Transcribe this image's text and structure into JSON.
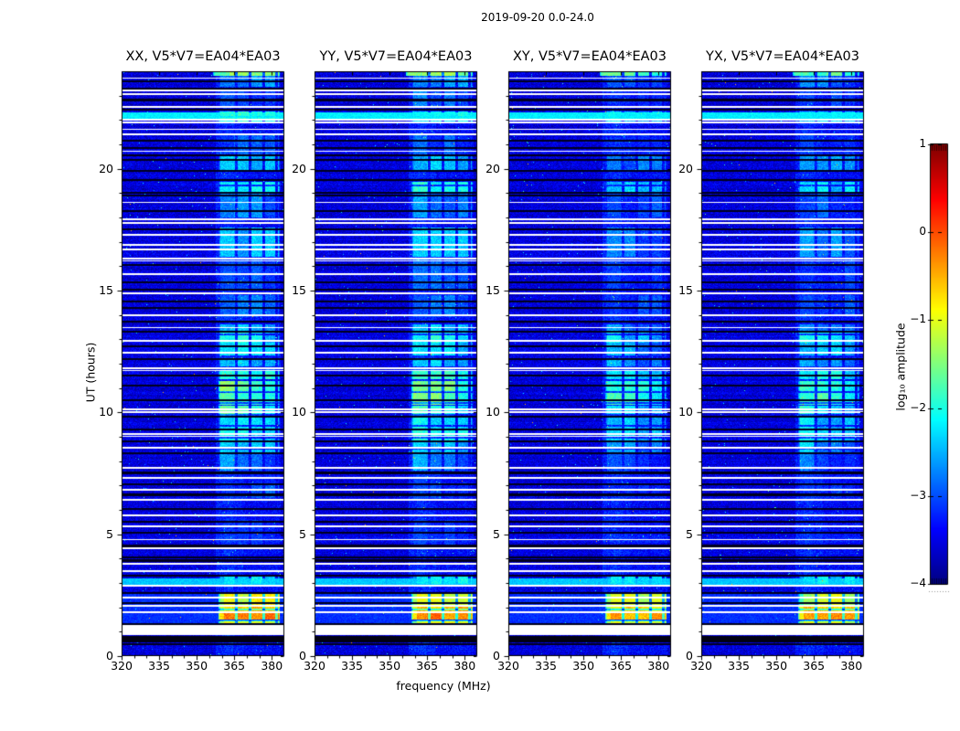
{
  "chart_data": {
    "type": "heatmap",
    "title": "2019-09-20 0.0-24.0",
    "xlabel": "frequency (MHz)",
    "ylabel": "UT (hours)",
    "x_ticks": [
      320,
      335,
      350,
      365,
      380
    ],
    "y_ticks": [
      0,
      5,
      10,
      15,
      20
    ],
    "x_range_mhz": [
      320,
      385
    ],
    "y_range_hours": [
      0,
      24
    ],
    "value_scale": "log10 amplitude",
    "value_range": [
      -4,
      1
    ],
    "colormap": "jet",
    "panels": [
      {
        "title": "XX, V5*V7=EA04*EA03",
        "pol": "XX",
        "band_offset": 0
      },
      {
        "title": "YY, V5*V7=EA04*EA03",
        "pol": "YY",
        "band_offset": 0.05
      },
      {
        "title": "XY, V5*V7=EA04*EA03",
        "pol": "XY",
        "band_offset": -0.3
      },
      {
        "title": "YX, V5*V7=EA04*EA03",
        "pol": "YX",
        "band_offset": -0.22
      }
    ],
    "colorbar": {
      "label": "log₁₀ amplitude",
      "ticks": [
        "1",
        "0",
        "−1",
        "−2",
        "−3",
        "−4"
      ],
      "vmin": -4,
      "vmax": 1
    },
    "features": {
      "background_level": -3.55,
      "rfi_band_mhz": [
        358.8,
        383.3
      ],
      "band_gap_freqs_mhz": [
        365.9,
        371.3,
        376.7,
        381.9
      ],
      "band_segments": [
        [
          23.82,
          24.0,
          -1.5
        ],
        [
          23.35,
          23.8,
          -2.7
        ],
        [
          22.55,
          23.3,
          -3.0
        ],
        [
          21.95,
          22.35,
          -2.1
        ],
        [
          20.6,
          21.4,
          -3.1
        ],
        [
          19.9,
          20.55,
          -2.5
        ],
        [
          19.05,
          19.45,
          -2.15
        ],
        [
          18.0,
          19.0,
          -2.85
        ],
        [
          16.4,
          17.6,
          -2.6
        ],
        [
          15.0,
          16.3,
          -3.0
        ],
        [
          13.9,
          14.8,
          -2.9
        ],
        [
          13.35,
          13.78,
          -2.3
        ],
        [
          12.88,
          13.3,
          -1.95
        ],
        [
          12.35,
          12.85,
          -2.1
        ],
        [
          11.88,
          12.3,
          -2.25
        ],
        [
          11.35,
          11.85,
          -1.7
        ],
        [
          10.85,
          11.3,
          -1.4
        ],
        [
          10.32,
          10.8,
          -1.55
        ],
        [
          9.85,
          10.28,
          -1.8
        ],
        [
          9.35,
          9.8,
          -2.0
        ],
        [
          8.85,
          9.3,
          -1.9
        ],
        [
          8.32,
          8.8,
          -2.2
        ],
        [
          7.6,
          8.28,
          -2.6
        ],
        [
          6.5,
          7.5,
          -3.1
        ],
        [
          4.4,
          5.6,
          -3.25
        ],
        [
          2.98,
          3.35,
          -2.25
        ],
        [
          2.1,
          2.58,
          -1.05
        ],
        [
          1.78,
          2.08,
          -0.62
        ],
        [
          1.5,
          1.76,
          -0.28
        ],
        [
          1.33,
          1.48,
          -0.95
        ]
      ],
      "row_bands": [
        [
          22.02,
          22.32,
          -2.2
        ],
        [
          2.93,
          3.18,
          -2.4
        ],
        [
          1.33,
          2.6,
          -3.15
        ]
      ],
      "flagged_white_rows_hours": [
        23.72,
        23.2,
        23.05,
        22.55,
        22.0,
        21.9,
        21.62,
        21.42,
        20.72,
        18.62,
        17.92,
        17.78,
        17.28,
        16.88,
        16.68,
        16.32,
        16.22,
        15.68,
        14.88,
        14.0,
        13.48,
        12.95,
        12.45,
        11.82,
        11.72,
        10.12,
        10.02,
        9.12,
        9.02,
        8.55,
        7.72,
        7.32,
        6.82,
        6.42,
        5.78,
        5.32,
        4.78,
        4.42,
        3.78,
        3.48,
        2.9,
        2.4,
        2.05,
        1.8
      ],
      "dark_rows_hours": [
        23.6,
        23.3,
        22.82,
        22.42,
        21.15,
        20.85,
        20.55,
        20.35,
        19.9,
        19.55,
        19.0,
        18.9,
        18.25,
        17.5,
        16.05,
        15.35,
        15.05,
        14.55,
        14.3,
        13.72,
        13.3,
        12.7,
        12.2,
        11.52,
        11.1,
        10.5,
        9.82,
        9.3,
        8.82,
        8.32,
        7.52,
        7.05,
        6.62,
        6.05,
        5.5,
        5.05,
        4.52,
        4.05,
        3.92,
        3.3,
        2.6,
        2.18,
        1.32,
        0.5
      ],
      "white_gap_hours": [
        0.85,
        1.28
      ],
      "black_gap_hours": [
        0.58,
        0.84
      ]
    }
  }
}
